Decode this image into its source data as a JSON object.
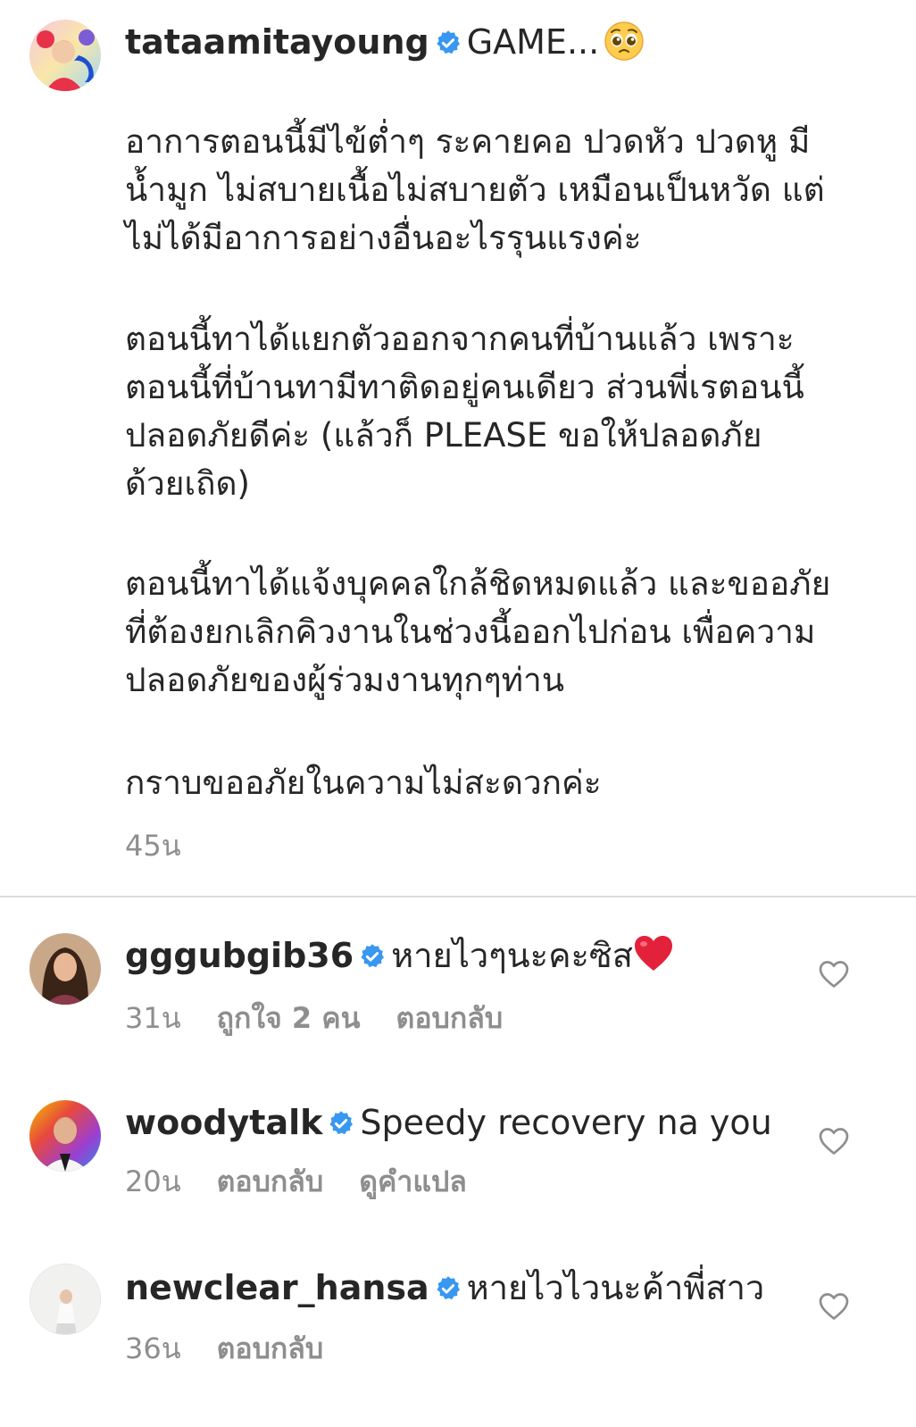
{
  "post": {
    "username": "tataamitayoung",
    "headline": "GAME...",
    "paragraphs": [
      "อาการตอนนี้มีไข้ต่ำๆ ระคายคอ ปวดหัว ปวดหู มี\nน้ำมูก ไม่สบายเนื้อไม่สบายตัว เหมือนเป็นหวัด แต่\nไม่ได้มีอาการอย่างอื่นอะไรรุนแรงค่ะ",
      "ตอนนี้ทาได้แยกตัวออกจากคนที่บ้านแล้ว เพราะ\nตอนนี้ที่บ้านทามีทาติดอยู่คนเดียว ส่วนพี่เรตอนนี้\nปลอดภัยดีค่ะ (แล้วก็ PLEASE ขอให้ปลอดภัย\nด้วยเถิด)",
      "ตอนนี้ทาได้แจ้งบุคคลใกล้ชิดหมดแล้ว และขออภัย\nที่ต้องยกเลิกคิวงานในช่วงนี้ออกไปก่อน เพื่อความ\nปลอดภัยของผู้ร่วมงานทุกๆท่าน",
      "กราบขออภัยในความไม่สะดวกค่ะ"
    ],
    "time": "45น"
  },
  "comments": [
    {
      "username": "gggubgib36",
      "text": "หายไวๆนะคะซิส",
      "time": "31น",
      "likes": "ถูกใจ 2 คน",
      "reply": "ตอบกลับ"
    },
    {
      "username": "woodytalk",
      "text": "Speedy recovery na you",
      "time": "20น",
      "reply": "ตอบกลับ",
      "translate": "ดูคำแปล"
    },
    {
      "username": "newclear_hansa",
      "text": "หายไวไวนะค้าพี่สาว",
      "time": "36น",
      "reply": "ตอบกลับ"
    }
  ],
  "icons": {
    "verified": "verified-badge-icon",
    "like": "heart-outline-icon",
    "pleading_emoji": "pleading-face-emoji",
    "heart_emoji": "red-heart-emoji"
  },
  "colors": {
    "verified": "#3897f0",
    "muted": "#8e8e8e",
    "text": "#262626",
    "divider": "#dbdbdb"
  }
}
